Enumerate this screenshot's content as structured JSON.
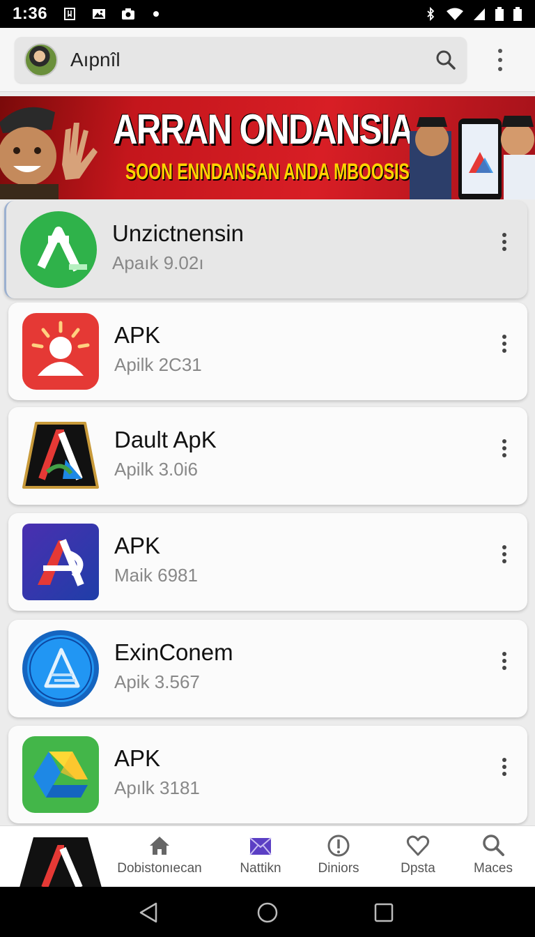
{
  "status_bar": {
    "time": "1:36"
  },
  "header": {
    "search_text": "Aıpnîl"
  },
  "banner": {
    "title": "ARRAN ONDANSIA",
    "subtitle": "SOON ENNDANSAN ANDA MBOOSIS"
  },
  "apps": [
    {
      "name": "Unzictnensin",
      "version": "Apaık 9.02ı",
      "icon": "green-triangle-app-icon"
    },
    {
      "name": "APK",
      "version": "Apilk 2C31",
      "icon": "red-person-app-icon"
    },
    {
      "name": "Dault ApK",
      "version": "Apilk 3.0i6",
      "icon": "black-colorful-a-app-icon"
    },
    {
      "name": "APK",
      "version": "Maik 6981",
      "icon": "purple-a-app-icon"
    },
    {
      "name": "ExinConem",
      "version": "Apik 3.567",
      "icon": "blue-circle-app-icon"
    },
    {
      "name": "APK",
      "version": "Apılk 3181",
      "icon": "drive-triangle-app-icon"
    }
  ],
  "bottom_nav": {
    "items": [
      {
        "label": "Dobistonıecan",
        "icon": "home-icon"
      },
      {
        "label": "Nattikn",
        "icon": "mail-icon"
      },
      {
        "label": "Diniors",
        "icon": "info-icon"
      },
      {
        "label": "Dpsta",
        "icon": "heart-icon"
      },
      {
        "label": "Maces",
        "icon": "search-icon"
      }
    ]
  },
  "colors": {
    "banner_red": "#d81e25",
    "banner_yellow": "#ffd400",
    "accent_purple": "#5b3fc4"
  }
}
